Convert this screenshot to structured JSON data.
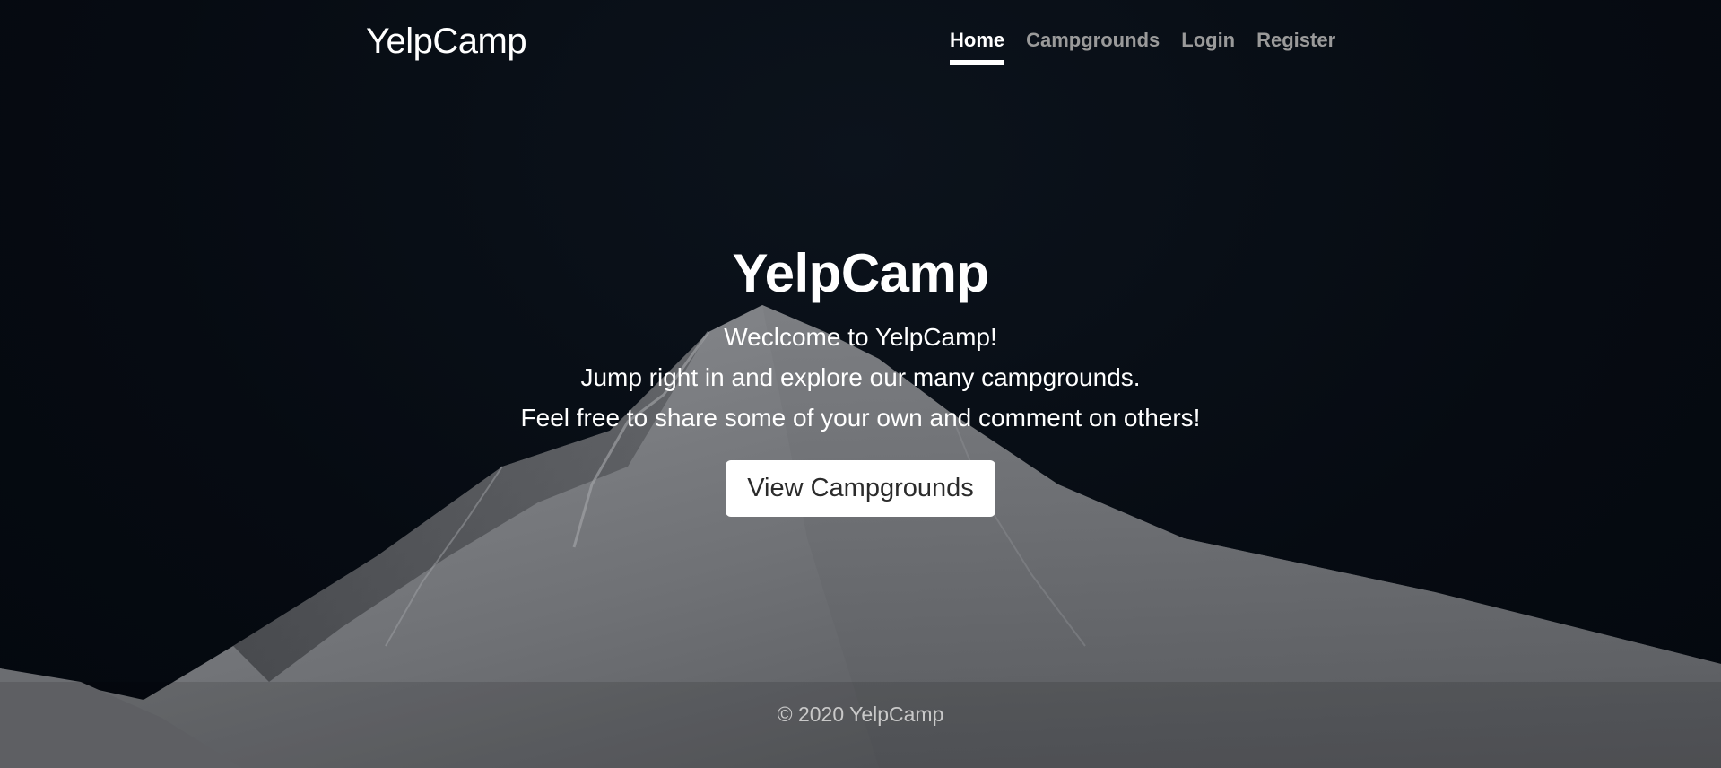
{
  "nav": {
    "brand": "YelpCamp",
    "links": [
      {
        "label": "Home",
        "active": true
      },
      {
        "label": "Campgrounds",
        "active": false
      },
      {
        "label": "Login",
        "active": false
      },
      {
        "label": "Register",
        "active": false
      }
    ]
  },
  "hero": {
    "title": "YelpCamp",
    "lines": [
      "Weclcome to YelpCamp!",
      "Jump right in and explore our many campgrounds.",
      "Feel free to share some of your own and comment on others!"
    ],
    "cta_label": "View Campgrounds"
  },
  "footer": {
    "text": "© 2020 YelpCamp"
  },
  "colors": {
    "background": "#060b12",
    "text": "#ffffff",
    "nav_inactive": "#9a9a9a",
    "button_bg": "#ffffff",
    "button_text": "#2b2b2b"
  }
}
